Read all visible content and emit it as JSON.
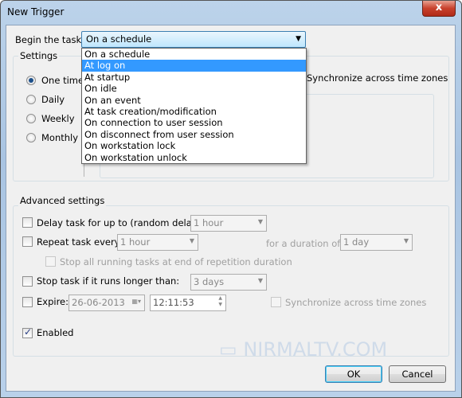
{
  "window": {
    "title": "New Trigger",
    "close": "x"
  },
  "begin": {
    "label": "Begin the task:",
    "value": "On a schedule",
    "options": [
      "On a schedule",
      "At log on",
      "At startup",
      "On idle",
      "On an event",
      "At task creation/modification",
      "On connection to user session",
      "On disconnect from user session",
      "On workstation lock",
      "On workstation unlock"
    ],
    "highlighted": "At log on"
  },
  "settings": {
    "label": "Settings",
    "radios": [
      "One time",
      "Daily",
      "Weekly",
      "Monthly"
    ],
    "selected": "One time",
    "sync": "Synchronize across time zones"
  },
  "advanced": {
    "label": "Advanced settings",
    "delay": {
      "label": "Delay task for up to (random delay):",
      "value": "1 hour"
    },
    "repeat": {
      "label": "Repeat task every:",
      "value": "1 hour",
      "duration_label": "for a duration of:",
      "duration": "1 day"
    },
    "stop_all": "Stop all running tasks at end of repetition duration",
    "stop_task": {
      "label": "Stop task if it runs longer than:",
      "value": "3 days"
    },
    "expire": {
      "label": "Expire:",
      "date": "26-06-2013",
      "time": "12:11:53",
      "sync": "Synchronize across time zones"
    },
    "enabled": {
      "label": "Enabled",
      "checked": true
    }
  },
  "buttons": {
    "ok": "OK",
    "cancel": "Cancel"
  },
  "watermark": "NIRMALTV.COM",
  "colors": {
    "highlight": "#3399ff"
  }
}
